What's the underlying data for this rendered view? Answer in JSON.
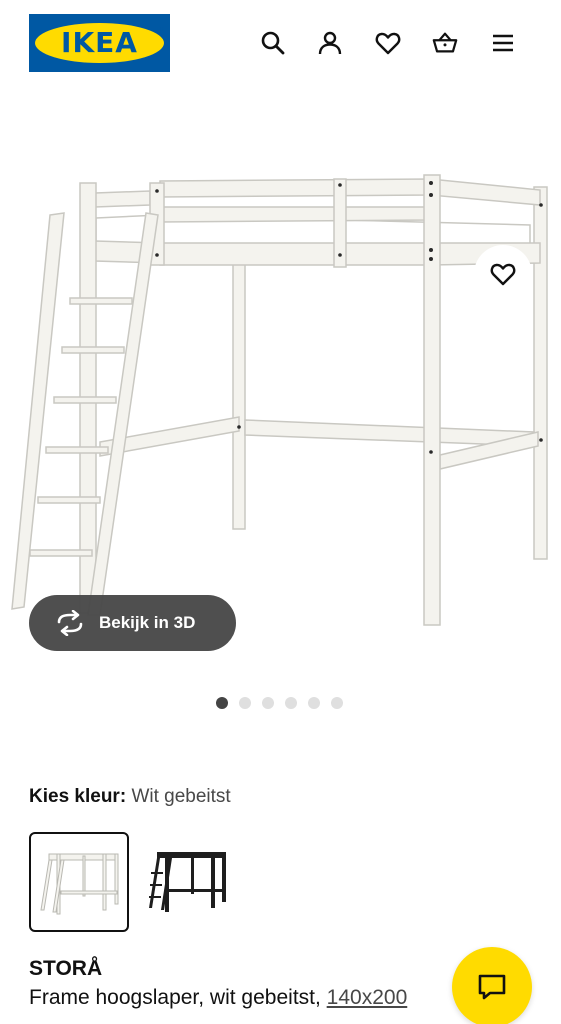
{
  "header": {
    "logo_text": "IKEA",
    "logo_mark": "®",
    "icons": [
      "search-icon",
      "account-icon",
      "heart-icon",
      "shopping-basket-icon",
      "menu-icon"
    ]
  },
  "gallery": {
    "view_3d_label": "Bekijk in 3D",
    "dots_total": 6,
    "active_dot": 1
  },
  "colour": {
    "label": "Kies kleur:",
    "value": "Wit gebeitst",
    "options": [
      "Wit gebeitst",
      "Zwart"
    ]
  },
  "product": {
    "name": "STORÅ",
    "description": "Frame hoogslaper, wit gebeitst,",
    "size": "140x200"
  },
  "colors": {
    "ikea_blue": "#0058a3",
    "ikea_yellow": "#ffdb00",
    "pill_bg": "#484848"
  }
}
